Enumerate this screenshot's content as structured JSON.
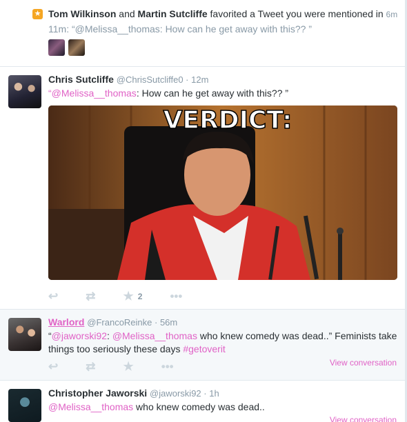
{
  "notification": {
    "icon": "star-icon",
    "user1": "Tom Wilkinson",
    "conj": " and ",
    "user2": "Martin Sutcliffe",
    "action": " favorited a Tweet you were mentioned in ",
    "time": "6m",
    "quote": "11m: “@Melissa__thomas: How can he get away with this?? ”"
  },
  "tweets": [
    {
      "name": "Chris Sutcliffe",
      "handle": "@ChrisSutcliffe0 · 12m",
      "mention": "“@Melissa__thomas",
      "text": ": How can he get away with this?? ”",
      "image_caption": "VERDICT:",
      "fav_count": "2"
    },
    {
      "name": "Warlord",
      "handle": "@FrancoReinke · 56m",
      "t_open": "“",
      "mention1": "@jaworski92",
      "t_sep": ": ",
      "mention2": "@Melissa__thomas",
      "text": " who knew comedy was dead..” Feminists take things too seriously these days ",
      "hashtag": "#getoverit",
      "view_conversation": "View conversation"
    },
    {
      "name": "Christopher Jaworski",
      "handle": "@jaworski92 · 1h",
      "mention": "@Melissa__thomas",
      "text": " who knew comedy was dead..",
      "view_conversation": "View conversation"
    }
  ],
  "icons": {
    "reply": "reply-icon",
    "retweet": "retweet-icon",
    "favorite": "star-icon",
    "more": "more-icon"
  },
  "colors": {
    "accent": "#e062c6",
    "muted": "#8899a6",
    "icon": "#ccd6dd",
    "badge": "#f5a623"
  }
}
